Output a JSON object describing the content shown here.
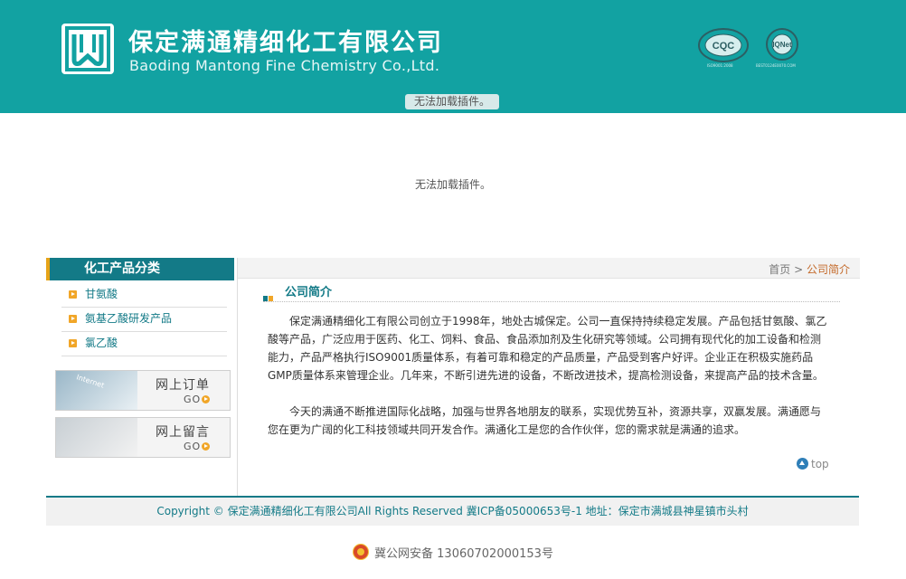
{
  "header": {
    "company_cn": "保定满通精细化工有限公司",
    "company_en": "Baoding Mantong Fine Chemistry Co.,Ltd.",
    "cert1_caption": "ISO9001:2008",
    "cert2_caption": "BEST0124E0070.COM",
    "plugin_msg": "无法加载插件。"
  },
  "flash": {
    "plugin_msg": "无法加载插件。"
  },
  "sidebar": {
    "title": "化工产品分类",
    "items": [
      {
        "label": "甘氨酸"
      },
      {
        "label": "氨基乙酸研发产品"
      },
      {
        "label": "氯乙酸"
      }
    ],
    "banners": [
      {
        "title": "网上订单",
        "go": "GO",
        "pic_text": "Internet"
      },
      {
        "title": "网上留言",
        "go": "GO",
        "pic_text": ""
      }
    ]
  },
  "breadcrumb": {
    "home": "首页",
    "sep": ">",
    "current": "公司简介"
  },
  "section": {
    "title": "公司简介",
    "paragraphs": [
      "保定满通精细化工有限公司创立于1998年，地处古城保定。公司一直保持持续稳定发展。产品包括甘氨酸、氯乙酸等产品，广泛应用于医药、化工、饲料、食品、食品添加剂及生化研究等领域。公司拥有现代化的加工设备和检测能力，产品严格执行ISO9001质量体系，有着可靠和稳定的产品质量，产品受到客户好评。企业正在积极实施药品GMP质量体系来管理企业。几年来，不断引进先进的设备，不断改进技术，提高检测设备，来提高产品的技术含量。",
      "今天的满通不断推进国际化战略，加强与世界各地朋友的联系，实现优势互补，资源共享，双赢发展。满通愿与您在更为广阔的化工科技领域共同开发合作。满通化工是您的合作伙伴，您的需求就是满通的追求。"
    ],
    "top_label": "top"
  },
  "footer": {
    "copyright": "Copyright © 保定满通精细化工有限公司All Rights Reserved  冀ICP备05000653号-1  地址：保定市满城县神星镇市头村",
    "police": "冀公网安备 13060702000153号"
  },
  "colors": {
    "header_bg": "#12a2a2",
    "accent": "#137a87",
    "orange": "#f1a628"
  },
  "icons": [
    "logo-icon",
    "cert-cqc-icon",
    "cert-iqnet-icon",
    "arrow-icon",
    "go-icon",
    "top-arrow-icon",
    "police-badge-icon"
  ]
}
